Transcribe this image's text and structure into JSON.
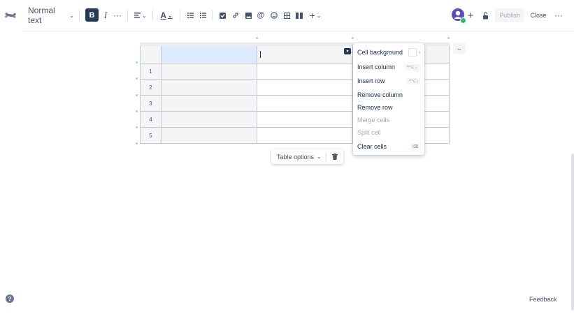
{
  "toolbar": {
    "text_style": "Normal text",
    "bold": "B",
    "italic": "I",
    "more": "···",
    "text_color": "A",
    "insert_plus": "+",
    "add_collaborator": "+",
    "publish": "Publish",
    "close": "Close",
    "overflow": "···"
  },
  "table": {
    "row_numbers": [
      "1",
      "2",
      "3",
      "4",
      "5"
    ]
  },
  "context_menu": {
    "items": [
      {
        "label": "Cell background",
        "shortcut": "›",
        "disabled": false
      },
      {
        "label": "Insert column",
        "shortcut": "^⌥→",
        "disabled": false
      },
      {
        "label": "Insert row",
        "shortcut": "^⌥↓",
        "disabled": false
      },
      {
        "label": "Remove column",
        "shortcut": "",
        "disabled": false
      },
      {
        "label": "Remove row",
        "shortcut": "",
        "disabled": false
      },
      {
        "label": "Merge cells",
        "shortcut": "",
        "disabled": true
      },
      {
        "label": "Split cell",
        "shortcut": "",
        "disabled": true
      },
      {
        "label": "Clear cells",
        "shortcut": "⌫",
        "disabled": false
      }
    ]
  },
  "table_toolbar": {
    "options_label": "Table options"
  },
  "footer": {
    "help": "?",
    "feedback": "Feedback"
  },
  "colors": {
    "accent_dark": "#253858",
    "selected_cell": "#deebff",
    "avatar": "#5e4db2"
  },
  "icons": [
    "confluence-logo-icon",
    "chevron-down-icon",
    "align-icon",
    "bullet-list-icon",
    "numbered-list-icon",
    "task-icon",
    "link-icon",
    "image-icon",
    "mention-icon",
    "emoji-icon",
    "table-icon",
    "layout-icon",
    "lock-icon",
    "trash-icon",
    "expand-icon",
    "help-icon"
  ]
}
